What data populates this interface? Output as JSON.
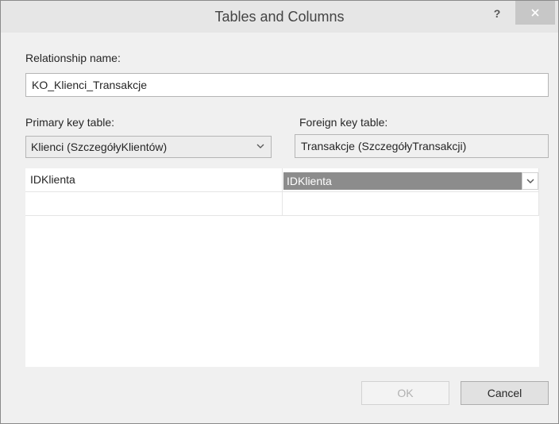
{
  "window": {
    "title": "Tables and Columns",
    "help_glyph": "?"
  },
  "relationship": {
    "label": "Relationship name:",
    "value": "KO_Klienci_Transakcje"
  },
  "primary_key": {
    "label": "Primary key table:",
    "selected": "Klienci (SzczegółyKlientów)"
  },
  "foreign_key": {
    "label": "Foreign key table:",
    "value": "Transakcje (SzczegółyTransakcji)"
  },
  "columns_grid": {
    "rows": [
      {
        "primary": "IDKlienta",
        "foreign": "IDKlienta"
      },
      {
        "primary": "",
        "foreign": ""
      }
    ]
  },
  "buttons": {
    "ok_label": "OK",
    "cancel_label": "Cancel",
    "ok_enabled": false
  },
  "colors": {
    "selection": "#8c8c8c",
    "dialog_background": "#f0f0f0"
  }
}
